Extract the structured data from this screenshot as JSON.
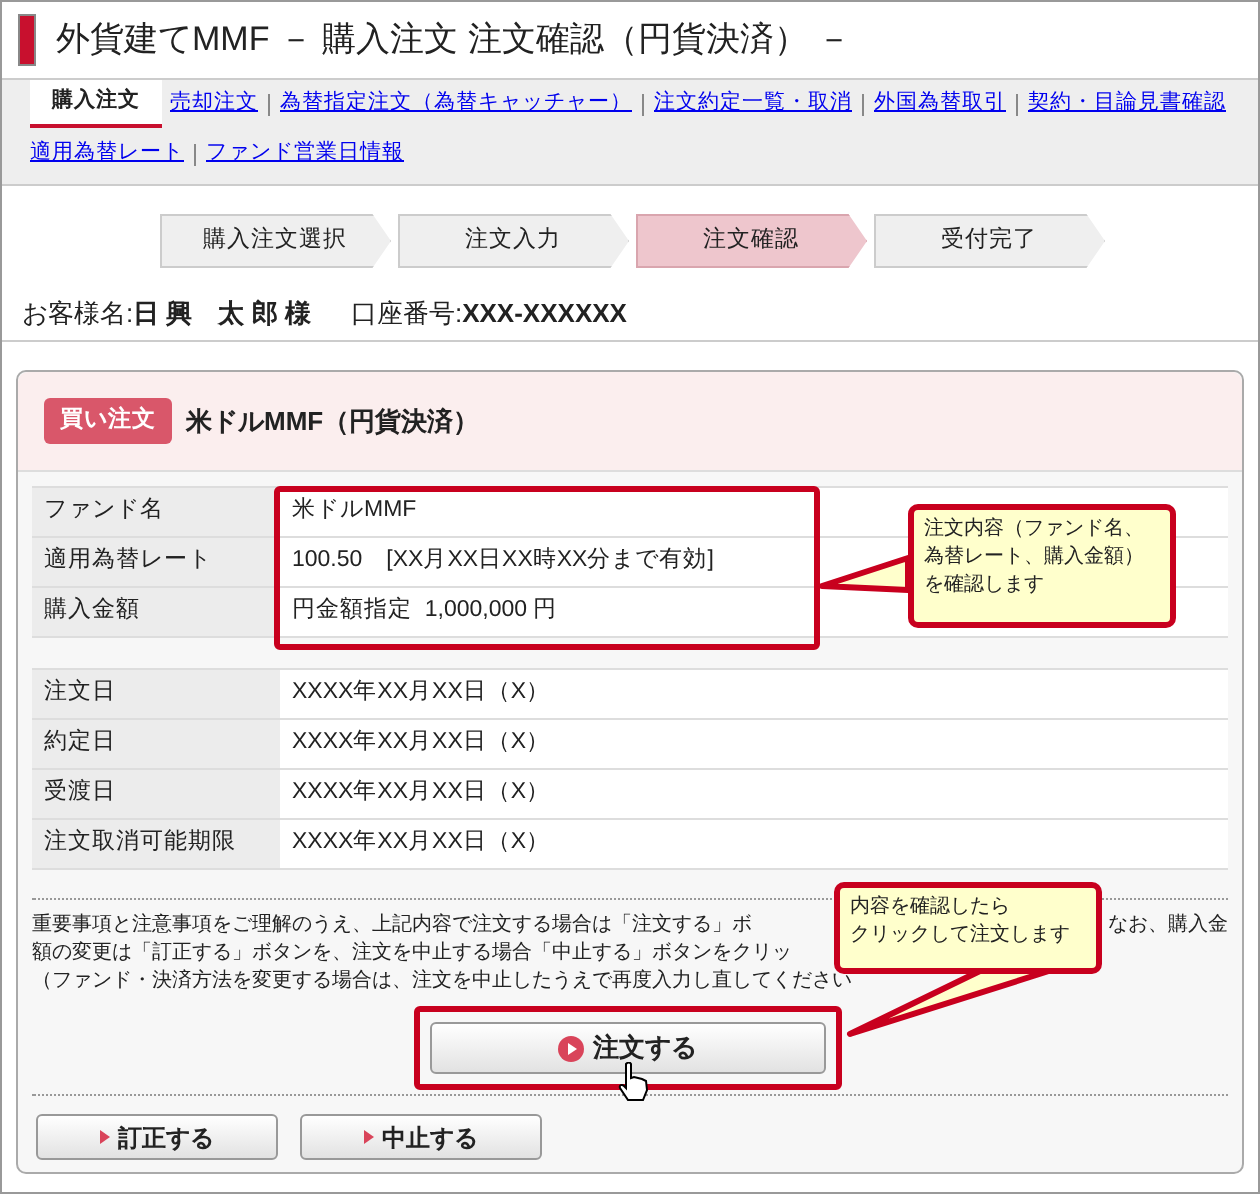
{
  "title": "外貨建てMMF － 購入注文 注文確認（円貨決済） －",
  "nav_rows": [
    [
      {
        "label": "購入注文",
        "selected": true
      },
      {
        "label": "売却注文",
        "selected": false
      },
      {
        "label": "為替指定注文（為替キャッチャー）",
        "selected": false
      },
      {
        "label": "注文約定一覧・取消",
        "selected": false
      },
      {
        "label": "外国為替取引",
        "selected": false
      },
      {
        "label": "契約・目論見書確認",
        "selected": false
      }
    ],
    [
      {
        "label": "適用為替レート",
        "selected": false
      },
      {
        "label": "ファンド営業日情報",
        "selected": false
      }
    ]
  ],
  "steps": [
    {
      "label": "購入注文選択",
      "selected": false
    },
    {
      "label": "注文入力",
      "selected": false
    },
    {
      "label": "注文確認",
      "selected": true
    },
    {
      "label": "受付完了",
      "selected": false
    }
  ],
  "customer": {
    "name_label": "お客様名:",
    "name": "日 興　太 郎 様",
    "account_label": "口座番号:",
    "account": "XXX-XXXXXX"
  },
  "order": {
    "badge": "買い注文",
    "title": "米ドルMMF（円貨決済）"
  },
  "details": [
    {
      "label": "ファンド名",
      "value": "米ドルMMF"
    },
    {
      "label": "適用為替レート",
      "value": "100.50　[XX月XX日XX時XX分まで有効]"
    },
    {
      "label": "購入金額",
      "value": "円金額指定  1,000,000 円"
    }
  ],
  "dates": [
    {
      "label": "注文日",
      "value": "XXXX年XX月XX日（X）"
    },
    {
      "label": "約定日",
      "value": "XXXX年XX月XX日（X）"
    },
    {
      "label": "受渡日",
      "value": "XXXX年XX月XX日（X）"
    },
    {
      "label": "注文取消可能期限",
      "value": "XXXX年XX月XX日（X）"
    }
  ],
  "notice_lines": [
    {
      "left": "重要事項と注意事項をご理解のうえ、上記内容で注文する場合は「注文する」ボ",
      "right": "なお、購入金"
    },
    {
      "left": "額の変更は「訂正する」ボタンを、注文を中止する場合「中止する」ボタンをクリッ"
    },
    {
      "left": "（ファンド・決済方法を変更する場合は、注文を中止したうえで再度入力し直してください"
    }
  ],
  "submit_button": "注文する",
  "buttons": [
    "訂正する",
    "中止する"
  ],
  "callouts": [
    {
      "lines": [
        "注文内容（ファンド名、",
        "為替レート、購入金額）",
        "を確認します"
      ]
    },
    {
      "lines": [
        "内容を確認したら",
        "クリックして注文します"
      ]
    }
  ]
}
